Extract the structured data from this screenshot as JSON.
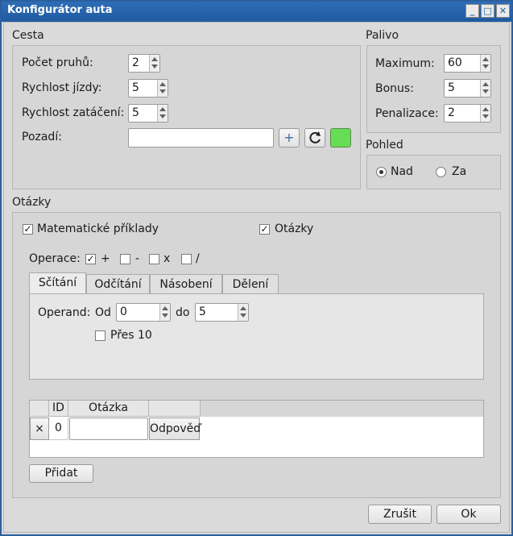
{
  "window": {
    "title": "Konfigurátor auta"
  },
  "cesta": {
    "title": "Cesta",
    "lanes_label": "Počet pruhů:",
    "lanes_value": "2",
    "speed_label": "Rychlost jízdy:",
    "speed_value": "5",
    "turn_label": "Rychlost zatáčení:",
    "turn_value": "5",
    "background_label": "Pozadí:",
    "background_value": "",
    "add_label": "+",
    "color_swatch": "#66dd55"
  },
  "palivo": {
    "title": "Palivo",
    "max_label": "Maximum:",
    "max_value": "60",
    "bonus_label": "Bonus:",
    "bonus_value": "5",
    "penalty_label": "Penalizace:",
    "penalty_value": "2"
  },
  "pohled": {
    "title": "Pohled",
    "options": [
      {
        "label": "Nad",
        "checked": true
      },
      {
        "label": "Za",
        "checked": false
      }
    ]
  },
  "otazky": {
    "title": "Otázky",
    "math_label": "Matematické příklady",
    "math_checked": "✓",
    "questions_label": "Otázky",
    "questions_checked": "✓",
    "ops_label": "Operace:",
    "ops": [
      {
        "label": "+",
        "mark": "✓"
      },
      {
        "label": "-",
        "mark": ""
      },
      {
        "label": "x",
        "mark": ""
      },
      {
        "label": "/",
        "mark": ""
      }
    ],
    "tabs": [
      "Sčítání",
      "Odčítání",
      "Násobení",
      "Dělení"
    ],
    "operand_label": "Operand:",
    "od_label": "Od",
    "od_value": "0",
    "do_label": "do",
    "do_value": "5",
    "over10_label": "Přes 10",
    "table": {
      "columns": [
        "",
        "ID",
        "Otázka",
        ""
      ],
      "rows": [
        {
          "delete": "×",
          "id": "0",
          "question": "",
          "answer_button": "Odpověď"
        }
      ]
    },
    "add_button": "Přidat"
  },
  "footer": {
    "cancel": "Zrušit",
    "ok": "Ok"
  }
}
